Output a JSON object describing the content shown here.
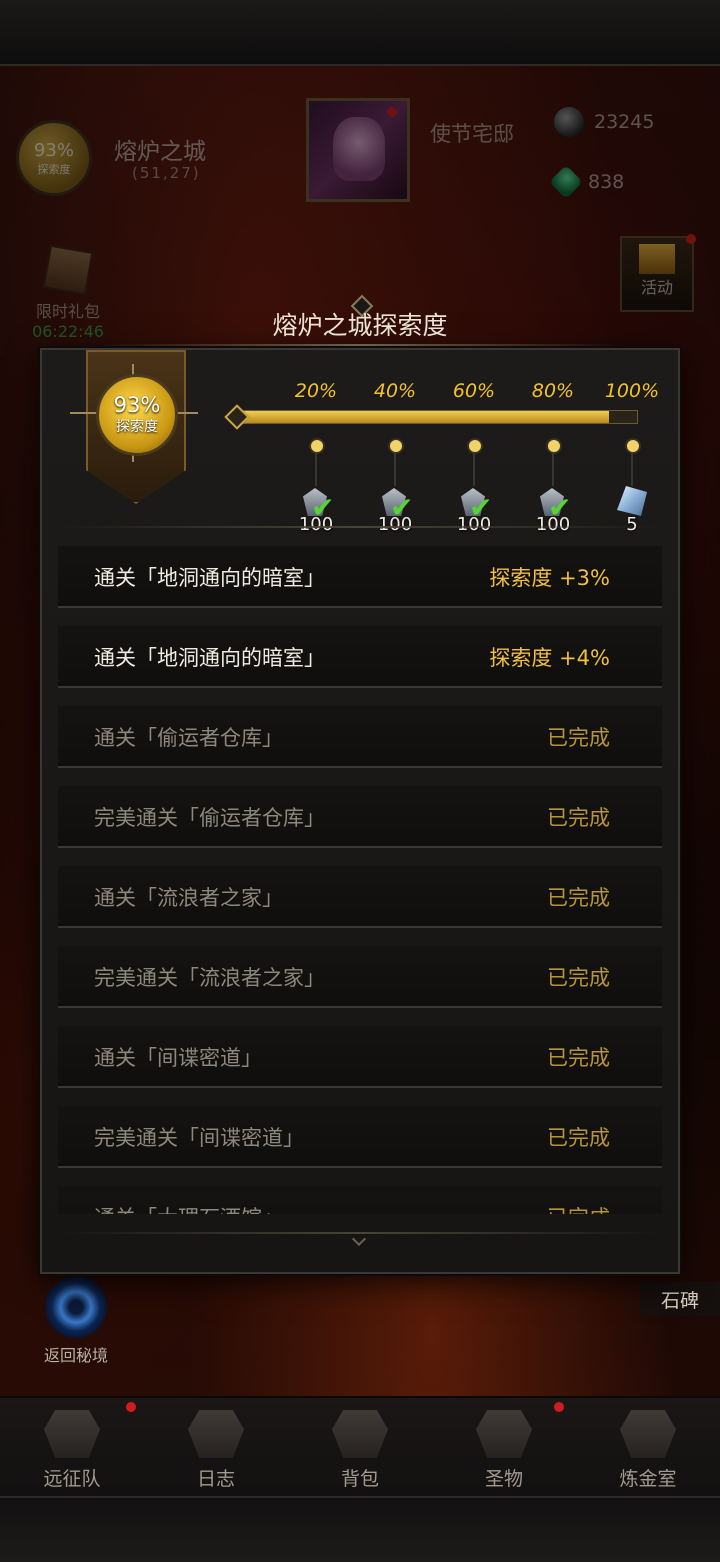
{
  "hud": {
    "explore_pct": "93%",
    "explore_label": "探索度",
    "city_name": "熔炉之城",
    "coords": "(51,27)",
    "envoy_label": "使节宅邸",
    "stone_count": "23245",
    "gem_count": "838",
    "gift_label": "限时礼包",
    "gift_timer": "06:22:46",
    "activity_label": "活动",
    "return_label": "返回秘境",
    "tablet_label": "石碑"
  },
  "modal": {
    "title": "熔炉之城探索度",
    "badge_pct": "93%",
    "badge_label": "探索度",
    "progress_fraction": 0.93,
    "milestones": [
      {
        "pct": "20%",
        "qty": "100",
        "claimed": true,
        "reward": "key-reward-icon"
      },
      {
        "pct": "40%",
        "qty": "100",
        "claimed": true,
        "reward": "key-reward-icon"
      },
      {
        "pct": "60%",
        "qty": "100",
        "claimed": true,
        "reward": "key-reward-icon"
      },
      {
        "pct": "80%",
        "qty": "100",
        "claimed": true,
        "reward": "key-reward-icon"
      },
      {
        "pct": "100%",
        "qty": "5",
        "claimed": false,
        "reward": "crystal-reward-icon"
      }
    ],
    "tasks": [
      {
        "name": "通关「地洞通向的暗室」",
        "status": "探索度 +3%",
        "done": false
      },
      {
        "name": "通关「地洞通向的暗室」",
        "status": "探索度 +4%",
        "done": false
      },
      {
        "name": "通关「偷运者仓库」",
        "status": "已完成",
        "done": true
      },
      {
        "name": "完美通关「偷运者仓库」",
        "status": "已完成",
        "done": true
      },
      {
        "name": "通关「流浪者之家」",
        "status": "已完成",
        "done": true
      },
      {
        "name": "完美通关「流浪者之家」",
        "status": "已完成",
        "done": true
      },
      {
        "name": "通关「间谍密道」",
        "status": "已完成",
        "done": true
      },
      {
        "name": "完美通关「间谍密道」",
        "status": "已完成",
        "done": true
      },
      {
        "name": "通关「大理石酒馆」",
        "status": "已完成",
        "done": true
      }
    ]
  },
  "nav": [
    {
      "label": "远征队",
      "badge": true
    },
    {
      "label": "日志",
      "badge": false
    },
    {
      "label": "背包",
      "badge": false
    },
    {
      "label": "圣物",
      "badge": true
    },
    {
      "label": "炼金室",
      "badge": false
    }
  ]
}
